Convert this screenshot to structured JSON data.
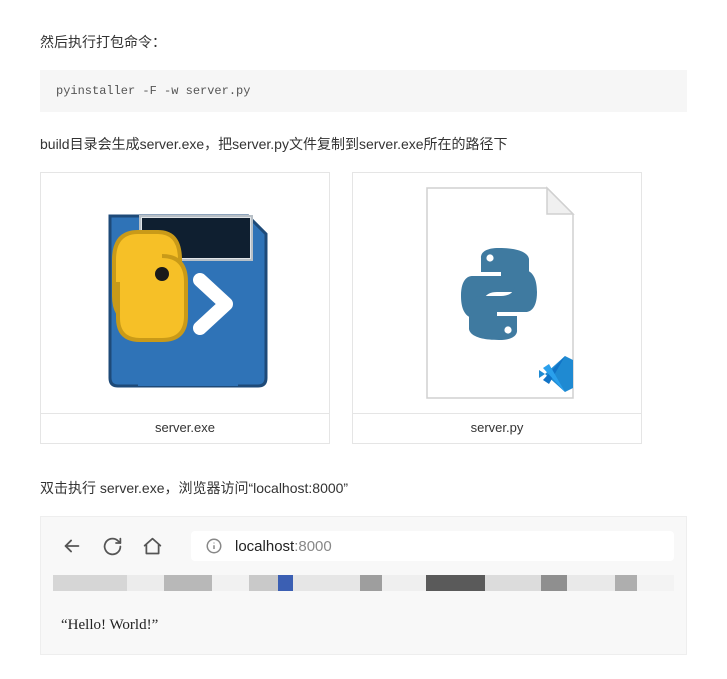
{
  "intro": "然后执行打包命令：",
  "code": "pyinstaller -F -w server.py",
  "after_build": "build目录会生成server.exe，把server.py文件复制到server.exe所在的路径下",
  "files": {
    "exe_caption": "server.exe",
    "py_caption": "server.py"
  },
  "run_note": "双击执行 server.exe，浏览器访问“localhost:8000”",
  "browser": {
    "url_host": "localhost",
    "url_port": ":8000",
    "output": "“Hello! World!”"
  }
}
